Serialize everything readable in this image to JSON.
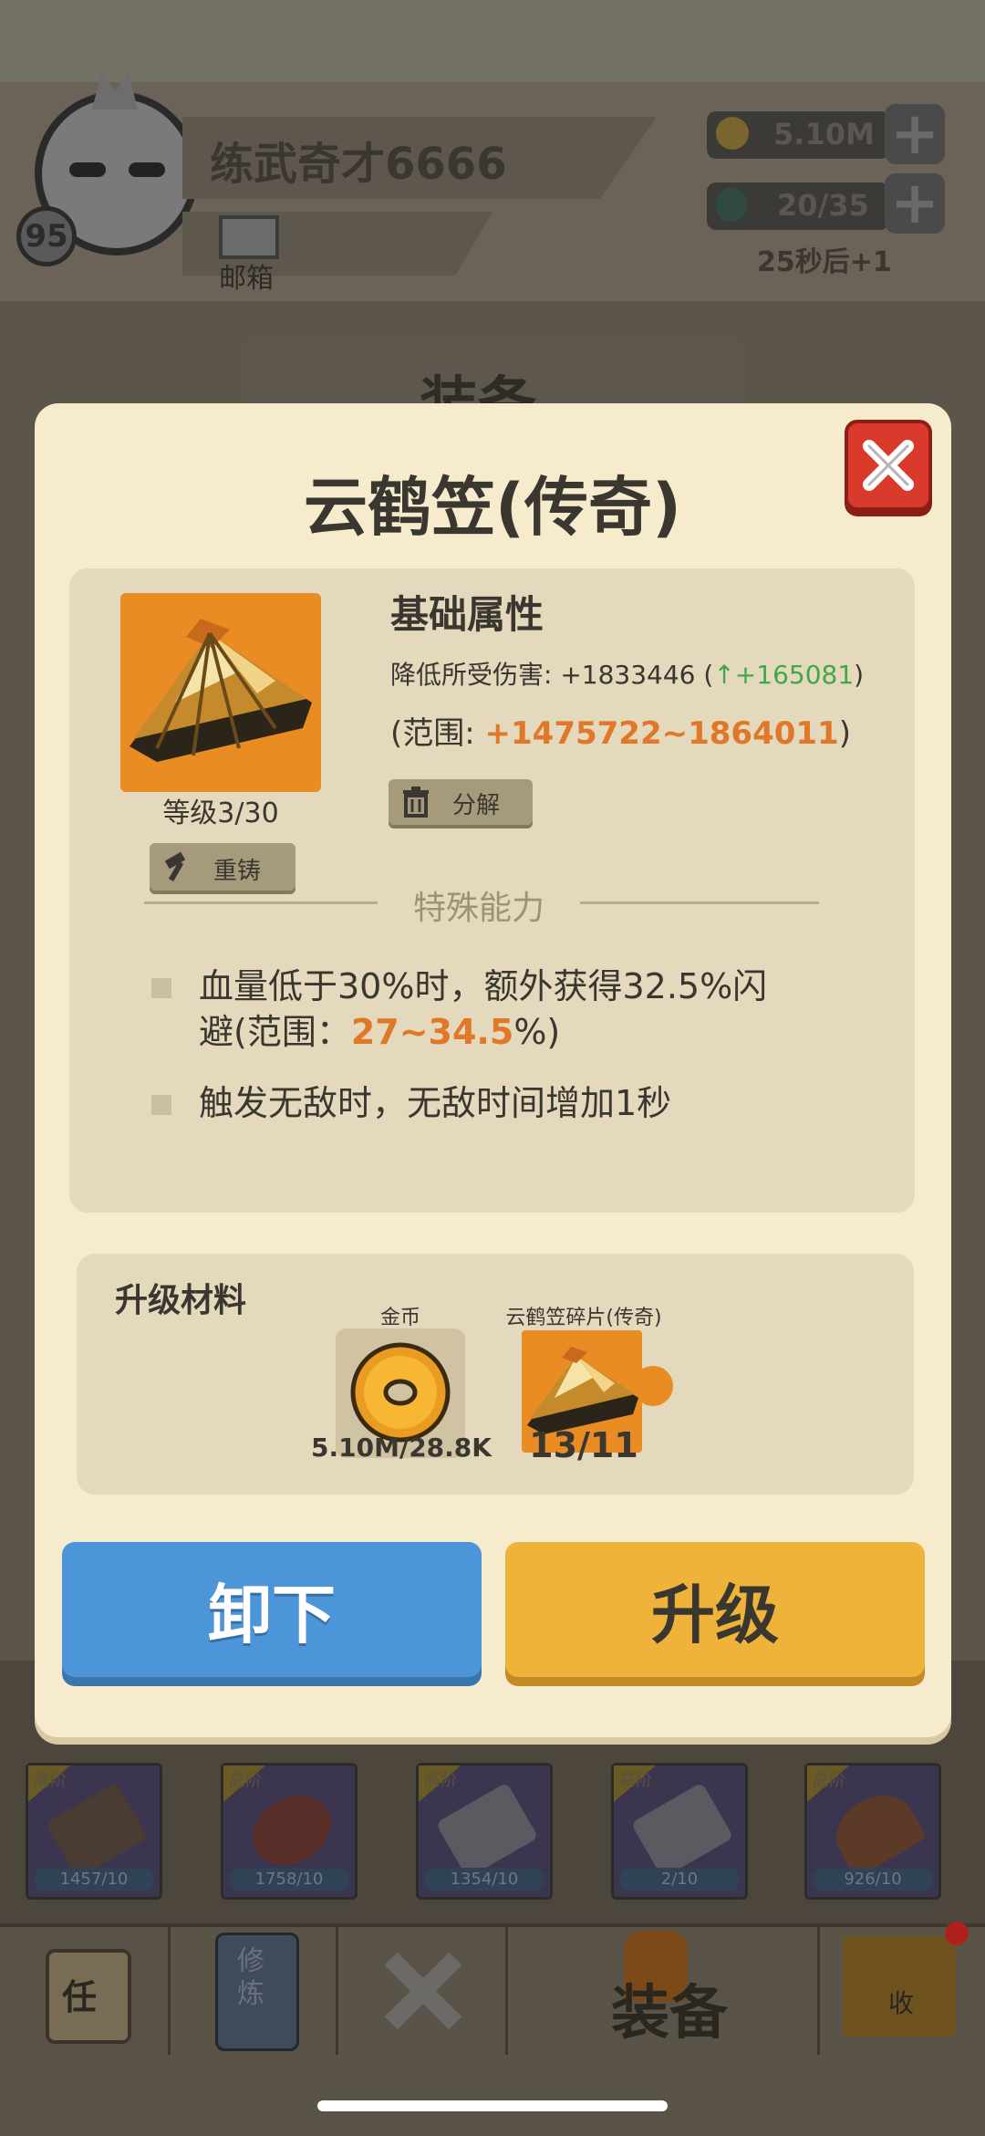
{
  "header": {
    "player_name": "练武奇才6666",
    "player_level": "95",
    "mail_label": "邮箱",
    "coins": "5.10M",
    "energy": "20/35",
    "energy_timer": "25秒后+1",
    "page_title": "装备"
  },
  "dialog": {
    "title": "云鹤笠(传奇)",
    "item_level": "等级3/30",
    "reforge_label": "重铸",
    "decompose_label": "分解",
    "base_attr_title": "基础属性",
    "base_attr_prefix": "降低所受伤害: +1833446 (",
    "base_attr_up": "↑+165081",
    "base_attr_suffix": ")",
    "range_prefix": "(范围: ",
    "range_value": "+1475722~1864011",
    "range_suffix": ")",
    "special_title": "特殊能力",
    "ability1_line1": "血量低于30%时，额外获得32.5%闪",
    "ability1_line2_prefix": "避(范围：",
    "ability1_line2_value": "27~34.5",
    "ability1_line2_suffix": "%)",
    "ability2": "触发无敌时，无敌时间增加1秒",
    "materials_title": "升级材料",
    "material_coin_name": "金币",
    "material_coin_count": "5.10M/28.8K",
    "material_shard_name": "云鹤笠碎片(传奇)",
    "material_shard_count": "13/11",
    "unequip_label": "卸下",
    "upgrade_label": "升级"
  },
  "inventory": {
    "items": [
      {
        "tag": "高阶",
        "count": "1457/10"
      },
      {
        "tag": "高阶",
        "count": "1758/10"
      },
      {
        "tag": "高阶",
        "count": "1354/10"
      },
      {
        "tag": "高阶",
        "count": "2/10"
      },
      {
        "tag": "高阶",
        "count": "926/10"
      }
    ]
  },
  "nav": {
    "active_label": "装备",
    "task_glyph": "任",
    "cultivate_glyph": "修炼",
    "collect_glyph": "收"
  },
  "colors": {
    "modal_bg": "#f7ebcd",
    "accent_orange": "#e0782a",
    "up_green": "#3fa84a",
    "unequip_blue": "#4b95d8",
    "upgrade_yellow": "#efb23a",
    "close_red": "#d93a2c"
  }
}
